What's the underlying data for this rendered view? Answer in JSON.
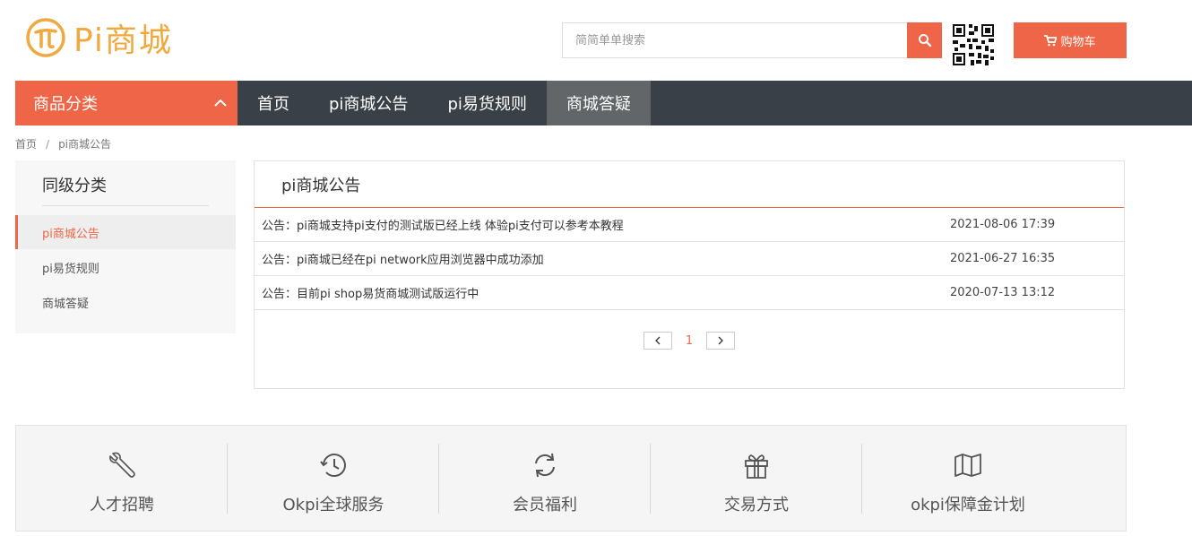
{
  "header": {
    "logo_text": "Pi商城",
    "search_placeholder": "简简单单搜索",
    "cart_label": "购物车",
    "brand_color": "#f0a93e",
    "accent_color": "#ef6547"
  },
  "nav": {
    "category_label": "商品分类",
    "items": [
      {
        "label": "首页"
      },
      {
        "label": "pi商城公告"
      },
      {
        "label": "pi易货规则"
      },
      {
        "label": "商城答疑"
      }
    ]
  },
  "breadcrumb": {
    "home": "首页",
    "sep": "/",
    "current": "pi商城公告"
  },
  "sidebar": {
    "title": "同级分类",
    "items": [
      {
        "label": "pi商城公告"
      },
      {
        "label": "pi易货规则"
      },
      {
        "label": "商城答疑"
      }
    ]
  },
  "main": {
    "title": "pi商城公告",
    "notices": [
      {
        "title": "公告：pi商城支持pi支付的测试版已经上线 体验pi支付可以参考本教程",
        "date": "2021-08-06 17:39"
      },
      {
        "title": "公告：pi商城已经在pi network应用浏览器中成功添加",
        "date": "2021-06-27 16:35"
      },
      {
        "title": "公告：目前pi shop易货商城测试版运行中",
        "date": "2020-07-13 13:12"
      }
    ],
    "pagination": {
      "current": "1"
    }
  },
  "services": [
    {
      "label": "人才招聘",
      "icon": "wrench-icon"
    },
    {
      "label": "Okpi全球服务",
      "icon": "history-clock-icon"
    },
    {
      "label": "会员福利",
      "icon": "refresh-icon"
    },
    {
      "label": "交易方式",
      "icon": "gift-icon"
    },
    {
      "label": "okpi保障金计划",
      "icon": "map-icon"
    }
  ]
}
